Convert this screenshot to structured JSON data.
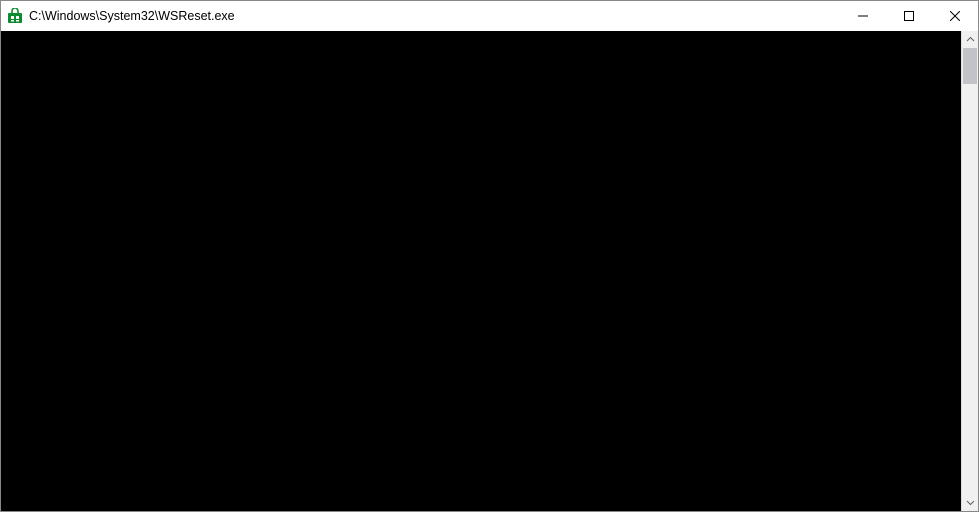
{
  "window": {
    "title": "C:\\Windows\\System32\\WSReset.exe",
    "icon_name": "store-icon",
    "icon_color": "#0f8b2f"
  },
  "console": {
    "content": ""
  }
}
